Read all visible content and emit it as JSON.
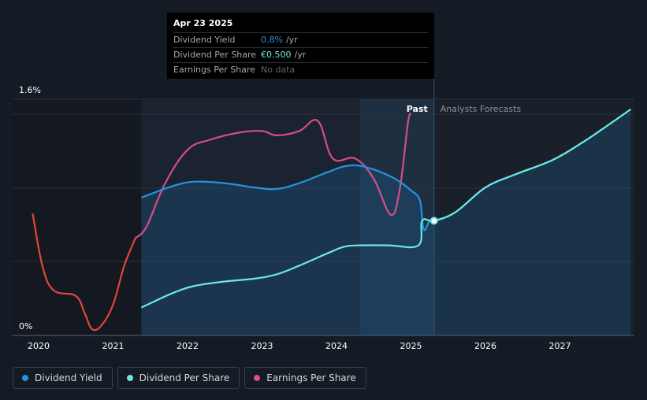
{
  "tooltip": {
    "date": "Apr 23 2025",
    "rows": [
      {
        "label": "Dividend Yield",
        "value": "0.8%",
        "unit": "/yr"
      },
      {
        "label": "Dividend Per Share",
        "value": "€0.500",
        "unit": "/yr"
      },
      {
        "label": "Earnings Per Share",
        "value": "No data",
        "unit": ""
      }
    ]
  },
  "legend": [
    {
      "label": "Dividend Yield",
      "color": "#2394df"
    },
    {
      "label": "Dividend Per Share",
      "color": "#6ee7e0"
    },
    {
      "label": "Earnings Per Share",
      "color": "#d54d8a"
    }
  ],
  "chart_data": {
    "type": "line",
    "title": "",
    "xlabel": "",
    "ylabel": "",
    "y_tick_labels": [
      "1.6%",
      "0%"
    ],
    "ylim": [
      0,
      1.6
    ],
    "xlim": [
      2019.7,
      2027.95
    ],
    "x_ticks": [
      2020,
      2021,
      2022,
      2023,
      2024,
      2025,
      2026,
      2027
    ],
    "x_tick_labels": [
      "2020",
      "2021",
      "2022",
      "2023",
      "2024",
      "2025",
      "2026",
      "2027"
    ],
    "grid": true,
    "legend_position": "bottom-left",
    "past_label": "Past",
    "forecast_label": "Analysts Forecasts",
    "highlight_start": 2024.32,
    "forecast_start": 2025.31,
    "colors": {
      "dividend_yield": "#2394df",
      "dividend_per_share": "#6ee7e0",
      "earnings_per_share_positive": "#d54d8a",
      "earnings_per_share_negative": "#e0463c"
    },
    "series": [
      {
        "name": "Dividend Yield",
        "points": [
          [
            2021.38,
            0.92
          ],
          [
            2021.8,
            1.0
          ],
          [
            2022.1,
            1.03
          ],
          [
            2022.5,
            1.02
          ],
          [
            2022.9,
            0.99
          ],
          [
            2023.2,
            0.98
          ],
          [
            2023.5,
            1.02
          ],
          [
            2023.9,
            1.1
          ],
          [
            2024.15,
            1.14
          ],
          [
            2024.4,
            1.13
          ],
          [
            2024.75,
            1.06
          ],
          [
            2025.0,
            0.97
          ],
          [
            2025.12,
            0.9
          ],
          [
            2025.17,
            0.7
          ],
          [
            2025.25,
            0.76
          ],
          [
            2025.31,
            0.76
          ],
          [
            2025.6,
            0.82
          ],
          [
            2026.0,
            0.99
          ],
          [
            2026.4,
            1.08
          ],
          [
            2026.9,
            1.18
          ],
          [
            2027.3,
            1.3
          ],
          [
            2027.7,
            1.44
          ],
          [
            2027.95,
            1.53
          ]
        ]
      },
      {
        "name": "Dividend Per Share",
        "points": [
          [
            2021.38,
            0.16
          ],
          [
            2021.8,
            0.26
          ],
          [
            2022.1,
            0.31
          ],
          [
            2022.5,
            0.34
          ],
          [
            2022.9,
            0.36
          ],
          [
            2023.2,
            0.39
          ],
          [
            2023.5,
            0.45
          ],
          [
            2023.9,
            0.54
          ],
          [
            2024.1,
            0.58
          ],
          [
            2024.3,
            0.59
          ],
          [
            2024.7,
            0.59
          ],
          [
            2025.1,
            0.59
          ],
          [
            2025.15,
            0.76
          ],
          [
            2025.31,
            0.76
          ],
          [
            2025.6,
            0.82
          ],
          [
            2026.0,
            0.99
          ],
          [
            2026.4,
            1.08
          ],
          [
            2026.9,
            1.18
          ],
          [
            2027.3,
            1.3
          ],
          [
            2027.7,
            1.44
          ],
          [
            2027.95,
            1.53
          ]
        ]
      },
      {
        "name": "Earnings Per Share",
        "points": [
          [
            2019.92,
            0.81
          ],
          [
            2020.05,
            0.45
          ],
          [
            2020.2,
            0.28
          ],
          [
            2020.5,
            0.24
          ],
          [
            2020.62,
            0.12
          ],
          [
            2020.72,
            0.01
          ],
          [
            2020.85,
            0.04
          ],
          [
            2021.0,
            0.18
          ],
          [
            2021.15,
            0.45
          ],
          [
            2021.3,
            0.64
          ],
          [
            2021.45,
            0.72
          ],
          [
            2021.7,
            1.02
          ],
          [
            2022.0,
            1.25
          ],
          [
            2022.3,
            1.32
          ],
          [
            2022.7,
            1.37
          ],
          [
            2023.0,
            1.38
          ],
          [
            2023.2,
            1.35
          ],
          [
            2023.5,
            1.38
          ],
          [
            2023.75,
            1.45
          ],
          [
            2023.95,
            1.19
          ],
          [
            2024.25,
            1.19
          ],
          [
            2024.5,
            1.05
          ],
          [
            2024.73,
            0.8
          ],
          [
            2024.85,
            0.98
          ],
          [
            2024.96,
            1.44
          ],
          [
            2025.0,
            1.5
          ]
        ]
      }
    ]
  }
}
